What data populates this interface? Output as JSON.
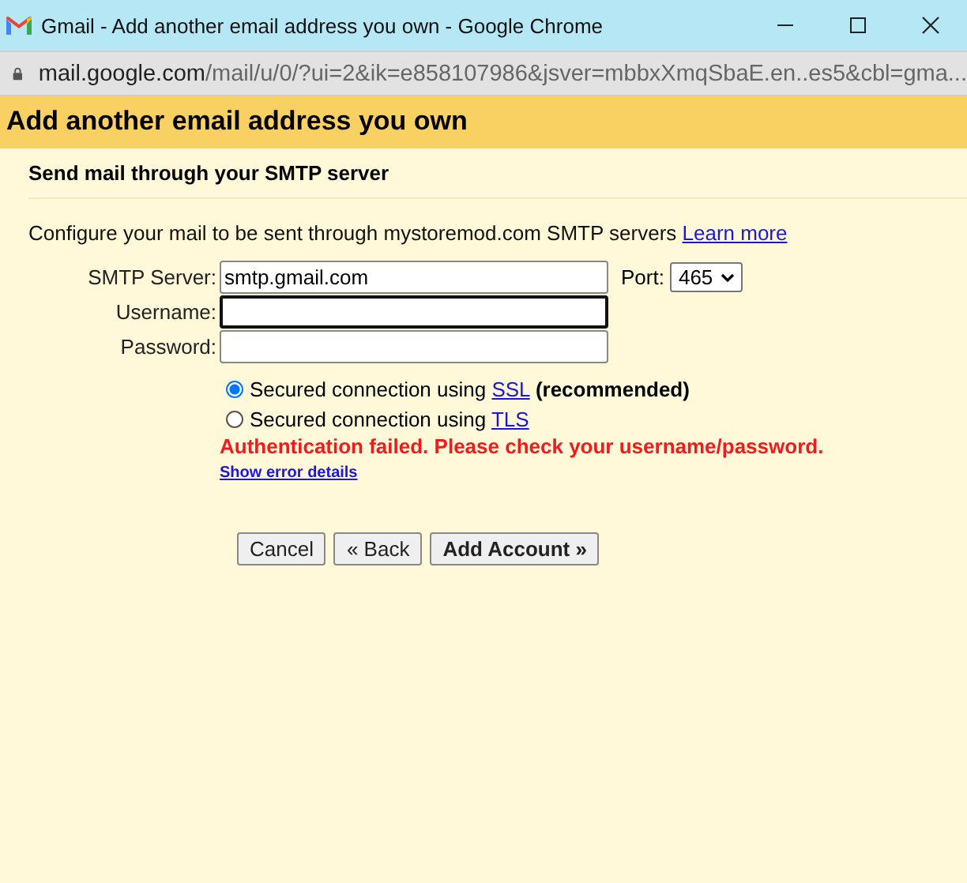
{
  "window": {
    "title": "Gmail - Add another email address you own - Google Chrome"
  },
  "address_bar": {
    "host": "mail.google.com",
    "path": "/mail/u/0/?ui=2&ik=e858107986&jsver=mbbxXmqSbaE.en..es5&cbl=gma..."
  },
  "page": {
    "heading": "Add another email address you own",
    "subheading": "Send mail through your SMTP server"
  },
  "intro": {
    "text": "Configure your mail to be sent through mystoremod.com SMTP servers",
    "link": "Learn more"
  },
  "fields": [
    {
      "label": "SMTP Server:",
      "value": "smtp.gmail.com",
      "focused": false
    },
    {
      "label": "Username:",
      "focused": true
    },
    {
      "label": "Password:",
      "focused": false
    }
  ],
  "port": {
    "label": "Port:",
    "value": "465"
  },
  "security": [
    {
      "text": "Secured connection using",
      "link": "SSL",
      "note": "(recommended)",
      "selected": true
    },
    {
      "text": "Secured connection using",
      "link": "TLS",
      "selected": false
    }
  ],
  "error": {
    "message": "Authentication failed. Please check your username/password.",
    "details_link": "Show error details"
  },
  "buttons": [
    {
      "label": "Cancel",
      "kind": "plain"
    },
    {
      "label": "« Back",
      "kind": "plain"
    },
    {
      "label": "Add Account »",
      "kind": "primary"
    }
  ]
}
